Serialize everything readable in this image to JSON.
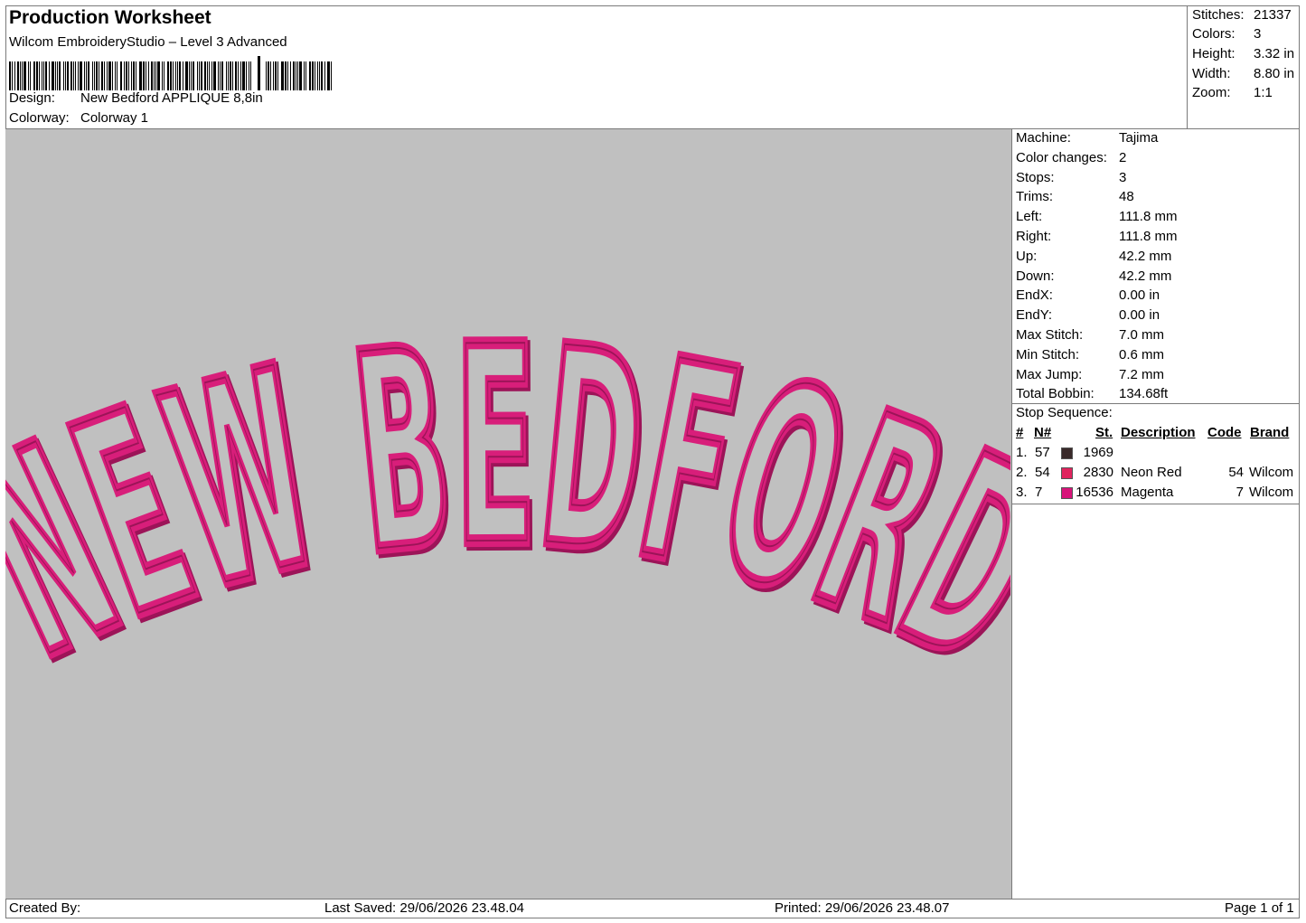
{
  "header": {
    "title": "Production Worksheet",
    "subtitle": "Wilcom EmbroideryStudio – Level 3 Advanced",
    "design_label": "Design:",
    "design_value": "New Bedford APPLIQUE 8,8in",
    "colorway_label": "Colorway:",
    "colorway_value": "Colorway 1"
  },
  "summary": {
    "stitches_label": "Stitches:",
    "stitches_value": "21337",
    "colors_label": "Colors:",
    "colors_value": "3",
    "height_label": "Height:",
    "height_value": "3.32 in",
    "width_label": "Width:",
    "width_value": "8.80 in",
    "zoom_label": "Zoom:",
    "zoom_value": "1:1"
  },
  "design_preview": {
    "text": "NEW BEDFORD",
    "fill_color": "#c0c0c0",
    "stitch_color": "#d81e7a",
    "shadow_color": "#9c1458",
    "background_color": "#c0c0c0"
  },
  "machine": [
    {
      "label": "Machine:",
      "value": "Tajima"
    },
    {
      "label": "Color changes:",
      "value": "2"
    },
    {
      "label": "Stops:",
      "value": "3"
    },
    {
      "label": "Trims:",
      "value": "48"
    },
    {
      "label": "Left:",
      "value": "111.8 mm"
    },
    {
      "label": "Right:",
      "value": "111.8 mm"
    },
    {
      "label": "Up:",
      "value": "42.2 mm"
    },
    {
      "label": "Down:",
      "value": "42.2 mm"
    },
    {
      "label": "EndX:",
      "value": "0.00 in"
    },
    {
      "label": "EndY:",
      "value": "0.00 in"
    },
    {
      "label": "Max Stitch:",
      "value": "7.0 mm"
    },
    {
      "label": "Min Stitch:",
      "value": "0.6 mm"
    },
    {
      "label": "Max Jump:",
      "value": "7.2 mm"
    },
    {
      "label": "Total Bobbin:",
      "value": "134.68ft"
    }
  ],
  "stop_sequence": {
    "title": "Stop Sequence:",
    "headers": {
      "num": "#",
      "needle": "N#",
      "stitches": "St.",
      "description": "Description",
      "code": "Code",
      "brand": "Brand"
    },
    "rows": [
      {
        "num": "1.",
        "needle": "57",
        "color": "#3a2a2a",
        "stitches": "1969",
        "description": "",
        "code": "",
        "brand": ""
      },
      {
        "num": "2.",
        "needle": "54",
        "color": "#e0245e",
        "stitches": "2830",
        "description": "Neon Red",
        "code": "54",
        "brand": "Wilcom"
      },
      {
        "num": "3.",
        "needle": "7",
        "color": "#d8147a",
        "stitches": "16536",
        "description": "Magenta",
        "code": "7",
        "brand": "Wilcom"
      }
    ]
  },
  "footer": {
    "created_by": "Created By:",
    "last_saved": "Last Saved: 29/06/2026 23.48.04",
    "printed": "Printed: 29/06/2026 23.48.07",
    "page": "Page 1 of 1"
  }
}
